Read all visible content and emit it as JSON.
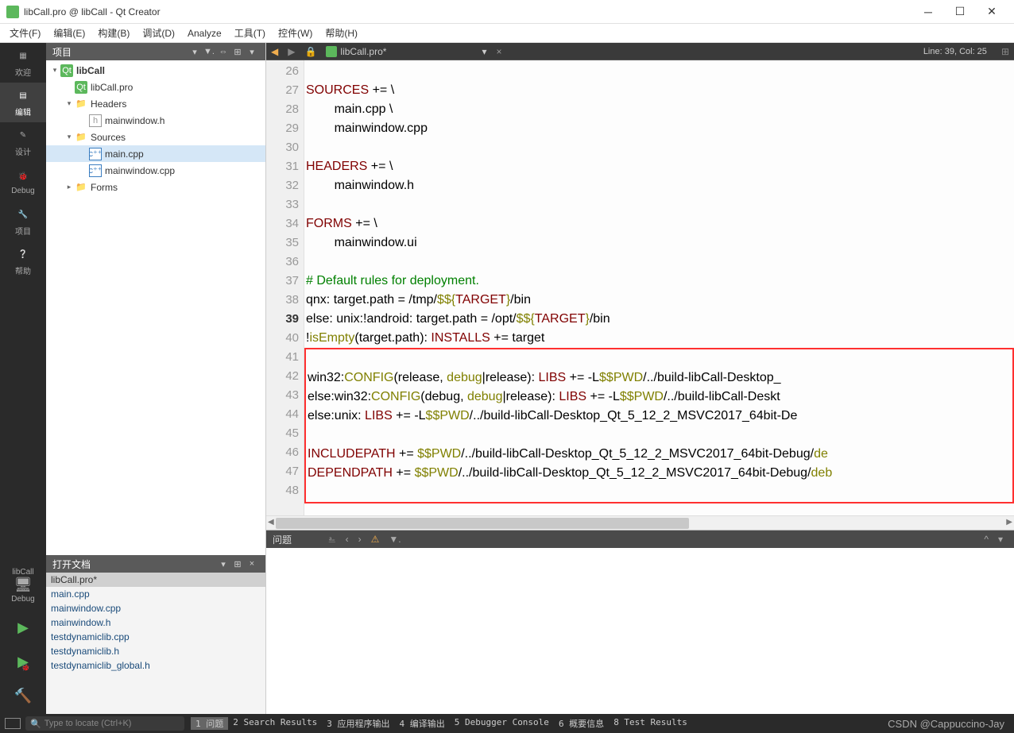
{
  "titlebar": {
    "title": "libCall.pro @ libCall - Qt Creator"
  },
  "menus": [
    "文件(F)",
    "编辑(E)",
    "构建(B)",
    "调试(D)",
    "Analyze",
    "工具(T)",
    "控件(W)",
    "帮助(H)"
  ],
  "modes": [
    {
      "label": "欢迎",
      "icon": "grid"
    },
    {
      "label": "编辑",
      "icon": "doc",
      "active": true
    },
    {
      "label": "设计",
      "icon": "pencil"
    },
    {
      "label": "Debug",
      "icon": "bug"
    },
    {
      "label": "项目",
      "icon": "wrench"
    },
    {
      "label": "帮助",
      "icon": "help"
    }
  ],
  "kit": {
    "target": "libCall",
    "device": "",
    "mode": "Debug"
  },
  "projectPanel": {
    "title": "项目",
    "tree": [
      {
        "depth": 0,
        "twisty": "v",
        "icon": "qt",
        "label": "libCall",
        "bold": true
      },
      {
        "depth": 1,
        "twisty": "",
        "icon": "qt",
        "label": "libCall.pro"
      },
      {
        "depth": 1,
        "twisty": "v",
        "icon": "folder",
        "label": "Headers"
      },
      {
        "depth": 2,
        "twisty": "",
        "icon": "h",
        "label": "mainwindow.h"
      },
      {
        "depth": 1,
        "twisty": "v",
        "icon": "folder",
        "label": "Sources"
      },
      {
        "depth": 2,
        "twisty": "",
        "icon": "cpp",
        "label": "main.cpp",
        "selected": true
      },
      {
        "depth": 2,
        "twisty": "",
        "icon": "cpp",
        "label": "mainwindow.cpp"
      },
      {
        "depth": 1,
        "twisty": ">",
        "icon": "folder",
        "label": "Forms"
      }
    ]
  },
  "openDocs": {
    "title": "打开文档",
    "items": [
      "libCall.pro*",
      "main.cpp",
      "mainwindow.cpp",
      "mainwindow.h",
      "testdynamiclib.cpp",
      "testdynamiclib.h",
      "testdynamiclib_global.h"
    ],
    "selected": 0
  },
  "editor": {
    "tab": {
      "name": "libCall.pro*"
    },
    "status": "Line: 39, Col: 25",
    "startLine": 26,
    "currentLine": 39,
    "lines": [
      {
        "n": 26,
        "seg": []
      },
      {
        "n": 27,
        "seg": [
          {
            "t": "SOURCES",
            "c": "maroon"
          },
          {
            "t": " += \\"
          }
        ]
      },
      {
        "n": 28,
        "seg": [
          {
            "t": "        main.cpp \\"
          }
        ]
      },
      {
        "n": 29,
        "seg": [
          {
            "t": "        mainwindow.cpp"
          }
        ]
      },
      {
        "n": 30,
        "seg": []
      },
      {
        "n": 31,
        "seg": [
          {
            "t": "HEADERS",
            "c": "maroon"
          },
          {
            "t": " += \\"
          }
        ]
      },
      {
        "n": 32,
        "seg": [
          {
            "t": "        mainwindow.h"
          }
        ]
      },
      {
        "n": 33,
        "seg": []
      },
      {
        "n": 34,
        "seg": [
          {
            "t": "FORMS",
            "c": "maroon"
          },
          {
            "t": " += \\"
          }
        ]
      },
      {
        "n": 35,
        "seg": [
          {
            "t": "        mainwindow.ui"
          }
        ]
      },
      {
        "n": 36,
        "seg": []
      },
      {
        "n": 37,
        "seg": [
          {
            "t": "# Default rules for deployment.",
            "c": "green"
          }
        ]
      },
      {
        "n": 38,
        "seg": [
          {
            "t": "qnx: target.path = /tmp/"
          },
          {
            "t": "$${",
            "c": "olive"
          },
          {
            "t": "TARGET",
            "c": "maroon"
          },
          {
            "t": "}",
            "c": "olive"
          },
          {
            "t": "/bin"
          }
        ]
      },
      {
        "n": 39,
        "seg": [
          {
            "t": "else: unix:!android: target.path = /opt/"
          },
          {
            "t": "$${",
            "c": "olive"
          },
          {
            "t": "TARGET",
            "c": "maroon"
          },
          {
            "t": "}",
            "c": "olive"
          },
          {
            "t": "/bin"
          }
        ]
      },
      {
        "n": 40,
        "seg": [
          {
            "t": "!"
          },
          {
            "t": "isEmpty",
            "c": "olive"
          },
          {
            "t": "(target.path): "
          },
          {
            "t": "INSTALLS",
            "c": "maroon"
          },
          {
            "t": " += target"
          }
        ]
      },
      {
        "n": 41,
        "seg": [],
        "hl": true
      },
      {
        "n": 42,
        "seg": [
          {
            "t": "win32:"
          },
          {
            "t": "CONFIG",
            "c": "olive"
          },
          {
            "t": "(release, "
          },
          {
            "t": "debug",
            "c": "olive"
          },
          {
            "t": "|release): "
          },
          {
            "t": "LIBS",
            "c": "maroon"
          },
          {
            "t": " += -L"
          },
          {
            "t": "$$PWD",
            "c": "olive"
          },
          {
            "t": "/../build-libCall-Desktop_"
          }
        ],
        "hl": true
      },
      {
        "n": 43,
        "seg": [
          {
            "t": "else:win32:"
          },
          {
            "t": "CONFIG",
            "c": "olive"
          },
          {
            "t": "(debug, "
          },
          {
            "t": "debug",
            "c": "olive"
          },
          {
            "t": "|release): "
          },
          {
            "t": "LIBS",
            "c": "maroon"
          },
          {
            "t": " += -L"
          },
          {
            "t": "$$PWD",
            "c": "olive"
          },
          {
            "t": "/../build-libCall-Deskt"
          }
        ],
        "hl": true
      },
      {
        "n": 44,
        "seg": [
          {
            "t": "else:unix: "
          },
          {
            "t": "LIBS",
            "c": "maroon"
          },
          {
            "t": " += -L"
          },
          {
            "t": "$$PWD",
            "c": "olive"
          },
          {
            "t": "/../build-libCall-Desktop_Qt_5_12_2_MSVC2017_64bit-De"
          }
        ],
        "hl": true
      },
      {
        "n": 45,
        "seg": [],
        "hl": true
      },
      {
        "n": 46,
        "seg": [
          {
            "t": "INCLUDEPATH",
            "c": "maroon"
          },
          {
            "t": " += "
          },
          {
            "t": "$$PWD",
            "c": "olive"
          },
          {
            "t": "/../build-libCall-Desktop_Qt_5_12_2_MSVC2017_64bit-Debug/"
          },
          {
            "t": "de",
            "c": "olive"
          }
        ],
        "hl": true
      },
      {
        "n": 47,
        "seg": [
          {
            "t": "DEPENDPATH",
            "c": "maroon"
          },
          {
            "t": " += "
          },
          {
            "t": "$$PWD",
            "c": "olive"
          },
          {
            "t": "/../build-libCall-Desktop_Qt_5_12_2_MSVC2017_64bit-Debug/"
          },
          {
            "t": "deb",
            "c": "olive"
          }
        ],
        "hl": true
      },
      {
        "n": 48,
        "seg": [],
        "hl": true
      }
    ]
  },
  "issues": {
    "title": "问题"
  },
  "locate": {
    "placeholder": "Type to locate (Ctrl+K)"
  },
  "bottom": [
    {
      "n": "1",
      "t": "问题",
      "active": true
    },
    {
      "n": "2",
      "t": "Search Results"
    },
    {
      "n": "3",
      "t": "应用程序输出"
    },
    {
      "n": "4",
      "t": "编译输出"
    },
    {
      "n": "5",
      "t": "Debugger Console"
    },
    {
      "n": "6",
      "t": "概要信息"
    },
    {
      "n": "8",
      "t": "Test Results"
    }
  ],
  "watermark": "CSDN @Cappuccino-Jay"
}
